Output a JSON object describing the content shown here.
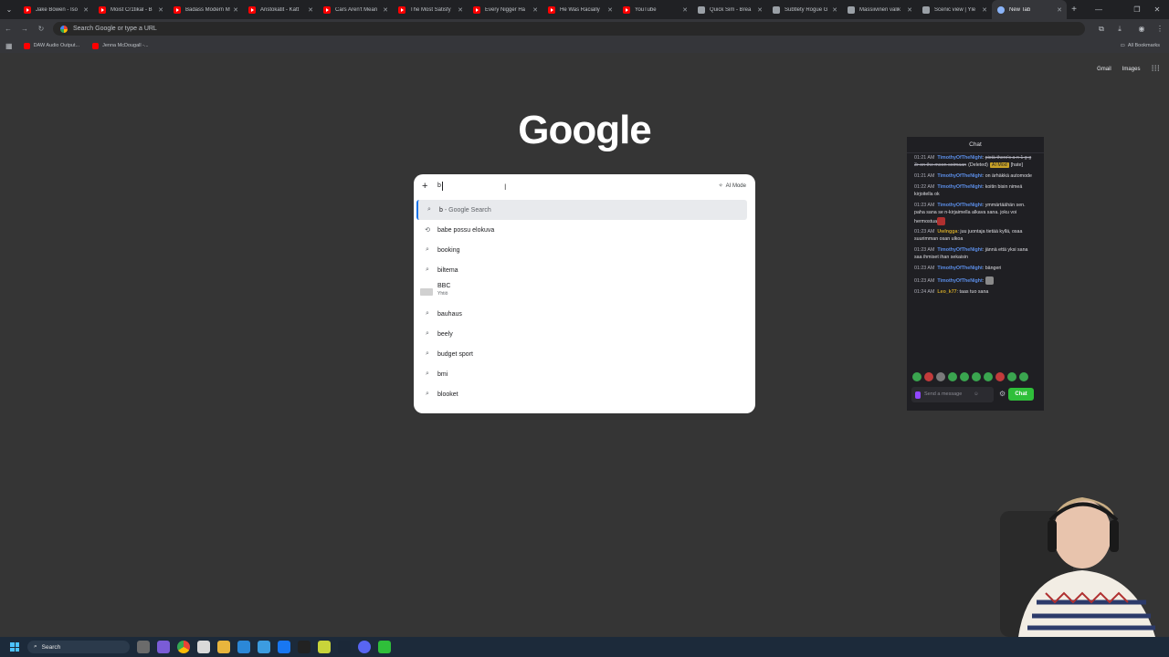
{
  "browser": {
    "tabs": [
      {
        "title": "Jake Bowen - Iso",
        "icon": "youtube-icon",
        "active": false
      },
      {
        "title": "Moist Cr1tikal - B",
        "icon": "youtube-icon",
        "active": false
      },
      {
        "title": "Badass Modern M",
        "icon": "youtube-icon",
        "active": false
      },
      {
        "title": "Aristokatit - Katt",
        "icon": "youtube-icon",
        "active": false
      },
      {
        "title": "Cars Aren't Mean",
        "icon": "youtube-icon",
        "active": false
      },
      {
        "title": "The Most Satisfy",
        "icon": "youtube-icon",
        "active": false
      },
      {
        "title": "Every Nigger Ha",
        "icon": "youtube-icon",
        "active": false
      },
      {
        "title": "He Was Racially",
        "icon": "youtube-icon",
        "active": false
      },
      {
        "title": "YouTube",
        "icon": "youtube-icon",
        "active": false
      },
      {
        "title": "Quick Sim - Brea",
        "icon": "site-icon",
        "active": false
      },
      {
        "title": "Subtlety Rogue G",
        "icon": "site-icon",
        "active": false
      },
      {
        "title": "Massiivinen valik",
        "icon": "site-icon",
        "active": false
      },
      {
        "title": "Scenic view | Yle",
        "icon": "site-icon",
        "active": false
      },
      {
        "title": "New Tab",
        "icon": "chrome-icon",
        "active": true
      }
    ],
    "omnibox_placeholder": "Search Google or type a URL",
    "bookmarks": [
      {
        "label": "DAW Audio Output..."
      },
      {
        "label": "Jenna McDougall -..."
      }
    ],
    "all_bookmarks_label": "All Bookmarks"
  },
  "newtab": {
    "links": {
      "gmail": "Gmail",
      "images": "Images"
    },
    "logo": "Google",
    "search": {
      "query": "b",
      "ai_mode_label": "AI Mode",
      "suggestions": [
        {
          "text": "b",
          "suffix": " - Google Search",
          "icon": "search-icon",
          "selected": true
        },
        {
          "text": "babe possu elokuva",
          "icon": "history-icon"
        },
        {
          "text": "booking",
          "icon": "search-icon"
        },
        {
          "text": "biltema",
          "icon": "search-icon"
        },
        {
          "text": "BBC",
          "sub": "Yhtiö",
          "icon": "entity-thumbnail"
        },
        {
          "text": "bauhaus",
          "icon": "search-icon"
        },
        {
          "text": "beely",
          "icon": "search-icon"
        },
        {
          "text": "budget sport",
          "icon": "search-icon"
        },
        {
          "text": "bmi",
          "icon": "search-icon"
        },
        {
          "text": "blooket",
          "icon": "search-icon"
        }
      ]
    }
  },
  "chat": {
    "title": "Chat",
    "messages": [
      {
        "time": "01:21 AM",
        "user": "TimothyOfTheNight",
        "text": "pistä there's a n 1 g g 3r on the moon soimaan",
        "deleted_label": "(Deleted)",
        "badge": "AI Mod",
        "tag": "[hate]"
      },
      {
        "time": "01:21 AM",
        "user": "TimothyOfTheNight",
        "text": "on ärhäkkä automode"
      },
      {
        "time": "01:22 AM",
        "user": "TimothyOfTheNight",
        "text": "koitin bisin nimeä kirjoitella ok"
      },
      {
        "time": "01:23 AM",
        "user": "TimothyOfTheNight",
        "text": "ymmärtäähän sen. paha sana se n-kirjaimella alkava sana. joku voi hermostua"
      },
      {
        "time": "01:23 AM",
        "user": "Uwlngga",
        "text": "juu juontaja tietää kyllä, osaa suurimman osan ulkoa"
      },
      {
        "time": "01:23 AM",
        "user": "TimothyOfTheNight",
        "text": "jännä että yksi sana saa ihmiset ihan sekaisin"
      },
      {
        "time": "01:23 AM",
        "user": "TimothyOfTheNight",
        "text": "bängeri"
      },
      {
        "time": "01:23 AM",
        "user": "TimothyOfTheNight",
        "text": ""
      },
      {
        "time": "01:24 AM",
        "user": "Leo_k77",
        "text": "taas tuo sana"
      }
    ],
    "input_placeholder": "Send a message",
    "send_label": "Chat"
  },
  "taskbar": {
    "search_label": "Search"
  }
}
